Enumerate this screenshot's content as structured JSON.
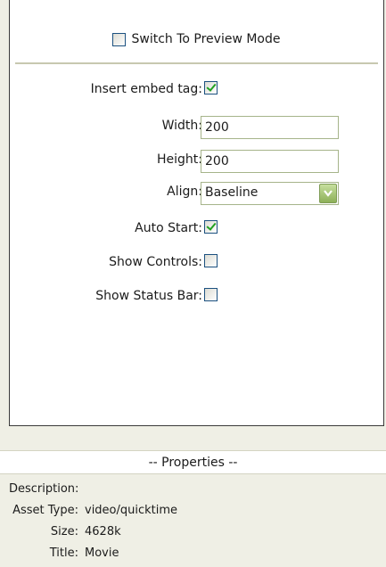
{
  "preview_mode": {
    "label": "Switch To Preview Mode",
    "checked": false
  },
  "form": {
    "insert_embed_tag": {
      "label": "Insert embed tag:",
      "checked": true
    },
    "width": {
      "label": "Width:",
      "value": "200"
    },
    "height": {
      "label": "Height:",
      "value": "200"
    },
    "align": {
      "label": "Align:",
      "value": "Baseline"
    },
    "auto_start": {
      "label": "Auto Start:",
      "checked": true
    },
    "show_controls": {
      "label": "Show Controls:",
      "checked": false
    },
    "show_status_bar": {
      "label": "Show Status Bar:",
      "checked": false
    }
  },
  "properties": {
    "header": "-- Properties --",
    "description": {
      "label": "Description:",
      "value": ""
    },
    "asset_type": {
      "label": "Asset Type:",
      "value": "video/quicktime"
    },
    "size": {
      "label": "Size:",
      "value": "4628k"
    },
    "title": {
      "label": "Title:",
      "value": "Movie"
    }
  },
  "colors": {
    "background": "#efefe5",
    "panel": "#ffffff",
    "check_green": "#21a121",
    "field_border": "#a6b48a",
    "dropdown_green": "#8db058"
  },
  "icons": {
    "checkbox": "checkbox-icon",
    "checkmark": "checkmark-icon",
    "dropdown": "chevron-down-icon"
  }
}
